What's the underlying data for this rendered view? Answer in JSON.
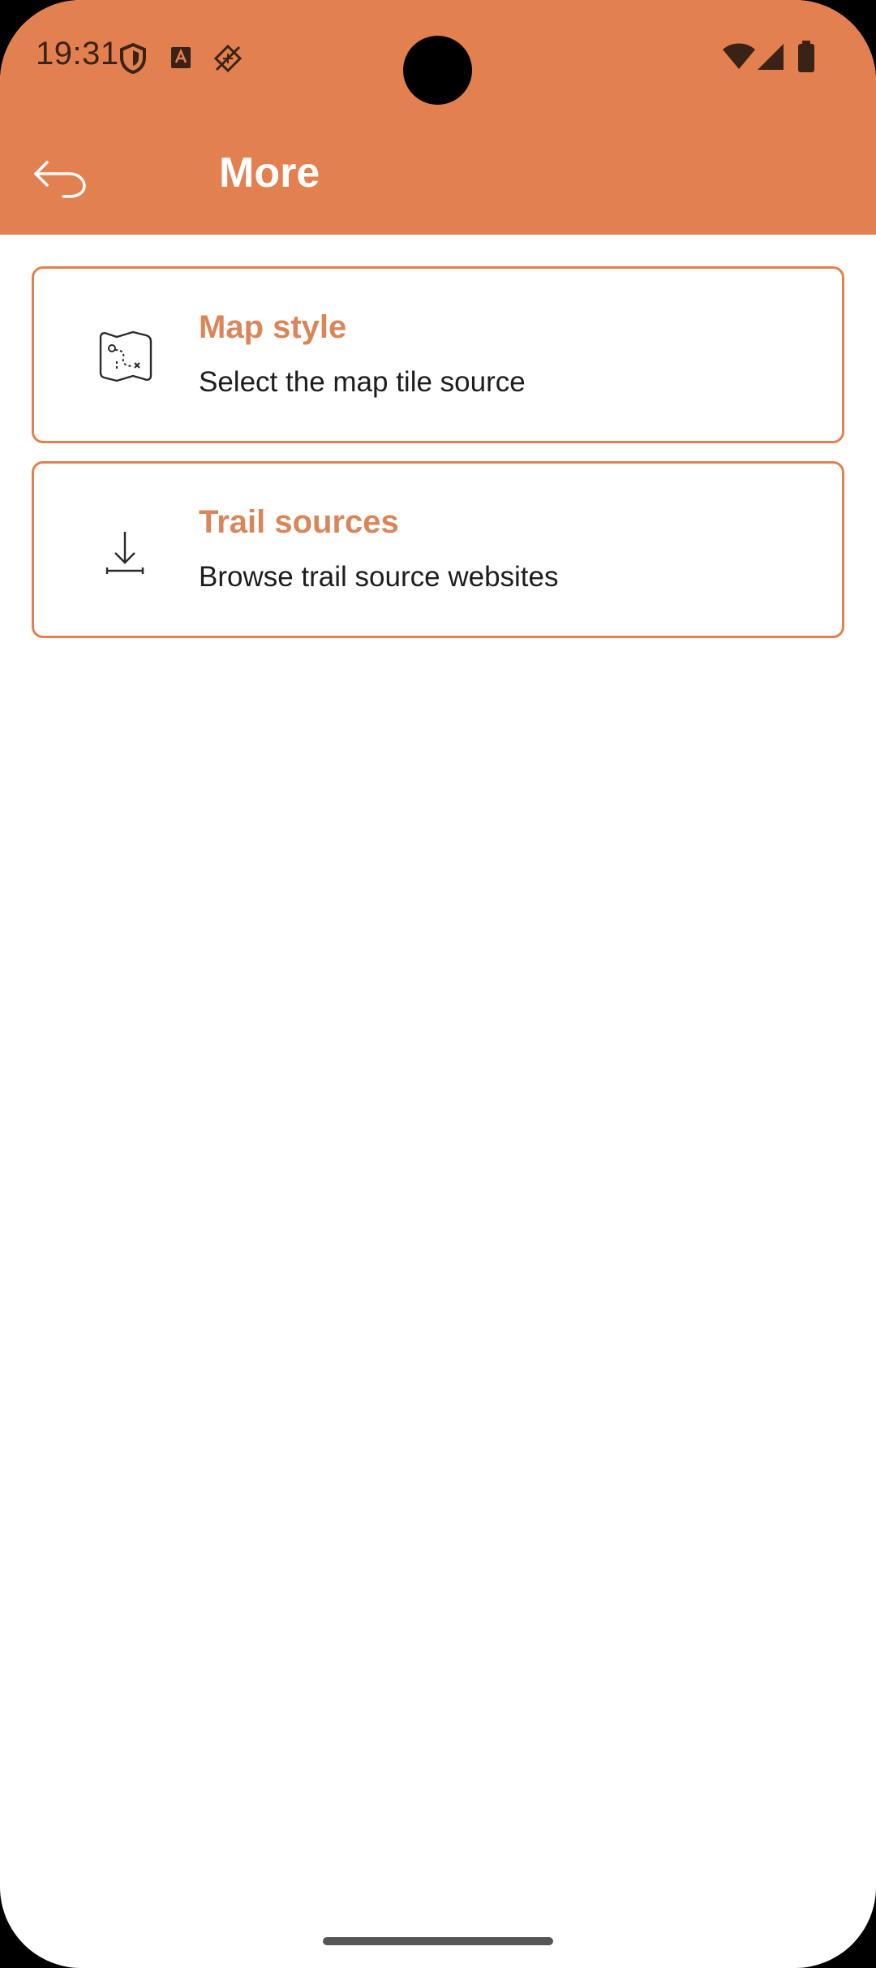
{
  "status_bar": {
    "time": "19:31",
    "icons": [
      "shield-icon",
      "a-badge-icon",
      "no-sim-icon",
      "wifi-icon",
      "signal-icon",
      "battery-icon"
    ]
  },
  "app_bar": {
    "title": "More",
    "back_icon": "back-arrow-icon"
  },
  "items": [
    {
      "title": "Map style",
      "subtitle": "Select the map tile source",
      "icon": "map-icon"
    },
    {
      "title": "Trail sources",
      "subtitle": "Browse trail source websites",
      "icon": "download-icon"
    }
  ],
  "colors": {
    "primary": "#E2804F",
    "title_text": "#D9875A",
    "body_text": "#1d1d1d",
    "background": "#ffffff"
  }
}
